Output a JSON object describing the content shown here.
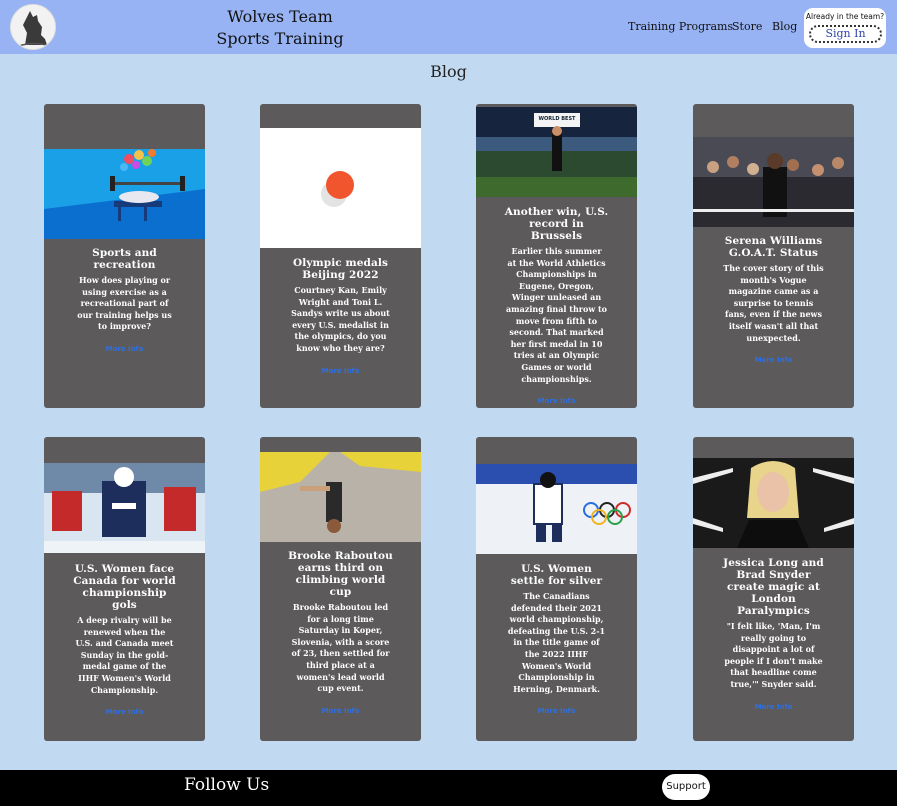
{
  "header": {
    "brand_line1": "Wolves Team",
    "brand_line2": "Sports Training",
    "nav": [
      "Training Programs",
      "Store",
      "Blog"
    ],
    "signin_prompt": "Already in the team?",
    "signin_label": "Sign In"
  },
  "page_title": "Blog",
  "more_label": "More Info",
  "cards": [
    {
      "title": "Sports and recreation",
      "text": "How does playing or using exercise as a recreational part of our training helps us to improve?"
    },
    {
      "title": "Olympic medals Beijing 2022",
      "text": "Courtney Kan, Emily Wright and Toni L. Sandys write us about every U.S. medalist in the olympics, do you know who they are?"
    },
    {
      "title": "Another win, U.S. record in Brussels",
      "text": "Earlier this summer at the World Athletics Championships in Eugene, Oregon, Winger unleased an amazing final throw to move from fifth to second. That marked her first medal in 10 tries at an Olympic Games or world championships."
    },
    {
      "title": "Serena Williams G.O.A.T. Status",
      "text": "The cover story of this month's Vogue magazine came as a surprise to tennis fans, even if the news itself wasn't all that unexpected."
    },
    {
      "title": "U.S. Women face Canada for world championship gols",
      "text": "A deep rivalry will be renewed when the U.S. and Canada meet Sunday in the gold-medal game of the IIHF Women's World Championship."
    },
    {
      "title": "Brooke Raboutou earns third on climbing world cup",
      "text": "Brooke Raboutou led for a long time Saturday in Koper, Slovenia, with a score of 23, then settled for third place at a women's lead world cup event."
    },
    {
      "title": "U.S. Women settle for silver",
      "text": "The Canadians defended their 2021 world championship, defeating the U.S. 2-1 in the title game of the 2022 IIHF Women's World Championship in Herning, Denmark."
    },
    {
      "title": "Jessica Long and Brad Snyder create magic at London Paralympics",
      "text": "\"I felt like, 'Man, I'm really going to disappoint a lot of people if I don't make that headline come true,'\" Snyder said."
    }
  ],
  "banner_text": "WORLD BEST",
  "footer": {
    "follow": "Follow Us",
    "support": "Support"
  },
  "colors": {
    "header_bg": "#98b3f3",
    "page_bg": "#c1d9f1",
    "card_bg": "#5c5a5b",
    "link": "#2f6fe0",
    "footer_bg": "#000000"
  }
}
